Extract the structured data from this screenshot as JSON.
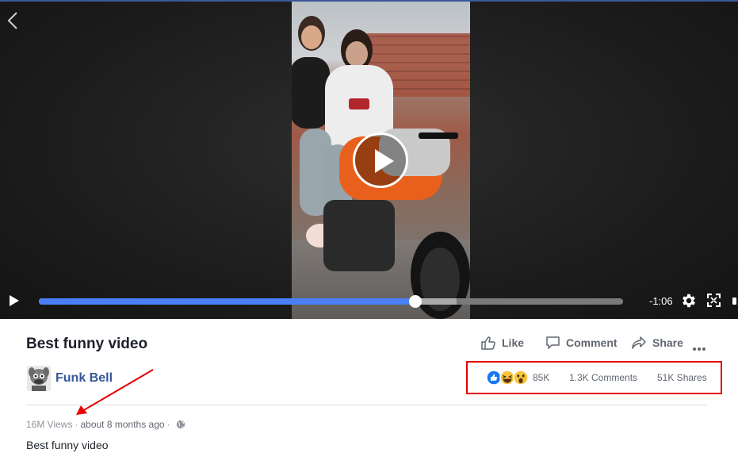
{
  "player": {
    "time_remaining": "-1:06",
    "progress_fraction": 0.645,
    "buffered_fraction": 0.715,
    "accent_color": "#4a7ff5"
  },
  "post": {
    "title": "Best funny video",
    "page_name": "Funk Bell",
    "actions": {
      "like": "Like",
      "comment": "Comment",
      "share": "Share"
    },
    "stats": {
      "reactions": [
        "like-icon",
        "haha-icon",
        "wow-icon"
      ],
      "reactions_count": "85K",
      "comments": "1.3K Comments",
      "shares": "51K Shares"
    },
    "meta": {
      "views": "16M Views",
      "separator": "·",
      "time_ago": "about 8 months ago",
      "privacy_icon": "globe-icon"
    },
    "description": "Best funny video"
  },
  "annotations": {
    "highlight_color": "#e60000"
  }
}
